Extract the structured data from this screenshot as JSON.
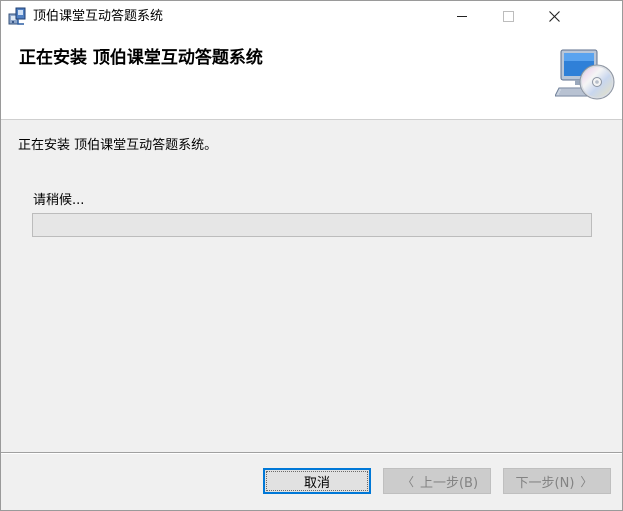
{
  "window": {
    "title": "顶伯课堂互动答题系统",
    "icon": "installer-icon",
    "controls": {
      "minimize": "minimize-icon",
      "maximize": "maximize-icon",
      "close": "✕"
    }
  },
  "header": {
    "title": "正在安装 顶伯课堂互动答题系统",
    "icon": "computer-cd-icon"
  },
  "content": {
    "status_text": "正在安装 顶伯课堂互动答题系统。",
    "wait_text": "请稍候...",
    "progress": 0
  },
  "buttons": {
    "cancel": "取消",
    "prev_arrow": "〈",
    "prev": "上一步(B)",
    "next": "下一步(N)",
    "next_arrow": "〉"
  },
  "colors": {
    "focus_border": "#0078d7",
    "disabled_text": "#838383",
    "header_bg": "#ffffff",
    "dialog_bg": "#f0f0f0"
  }
}
